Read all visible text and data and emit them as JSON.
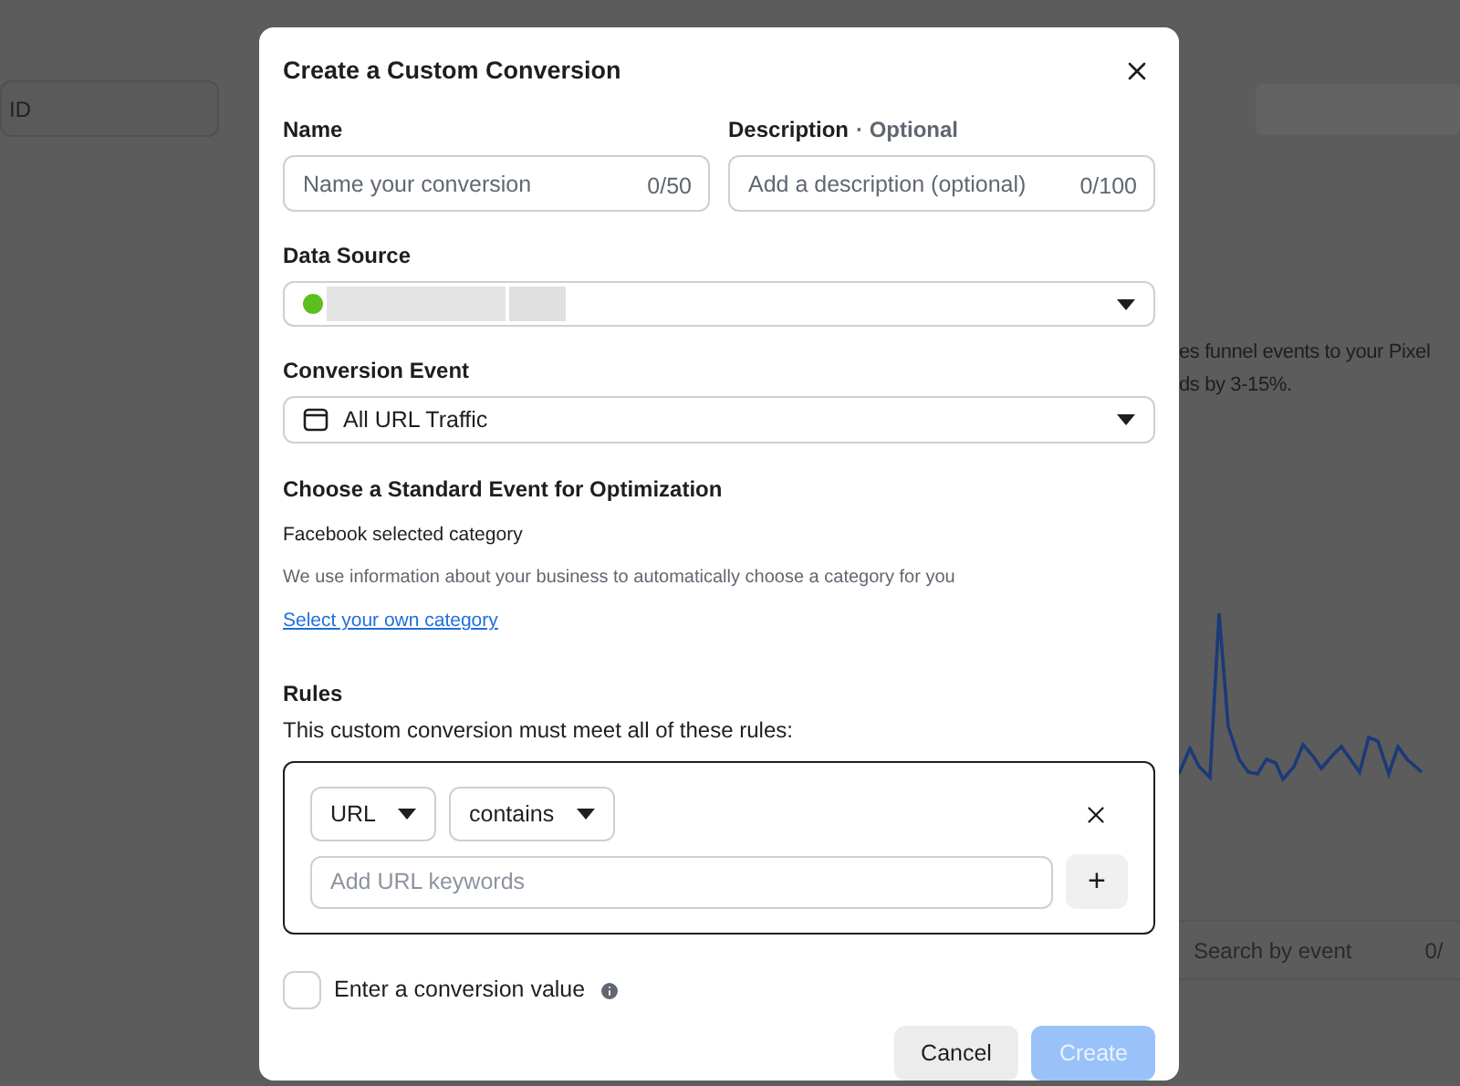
{
  "background": {
    "id_field": "ID",
    "description_lines": [
      "es funnel events to your Pixel",
      "ds by 3-15%."
    ],
    "search": {
      "placeholder": "Search by event",
      "counter": "0/"
    }
  },
  "dialog": {
    "title": "Create a Custom Conversion",
    "name": {
      "label": "Name",
      "placeholder": "Name your conversion",
      "counter": "0/50"
    },
    "description": {
      "label": "Description",
      "optional": "· Optional",
      "placeholder": "Add a description (optional)",
      "counter": "0/100"
    },
    "data_source": {
      "label": "Data Source",
      "connected": true
    },
    "conversion_event": {
      "label": "Conversion Event",
      "value": "All URL Traffic"
    },
    "standard_event": {
      "heading": "Choose a Standard Event for Optimization",
      "subheading": "Facebook selected category",
      "help": "We use information about your business to automatically choose a category for you",
      "link": "Select your own category"
    },
    "rules": {
      "heading": "Rules",
      "subtitle": "This custom conversion must meet all of these rules:",
      "field": "URL",
      "operator": "contains",
      "placeholder": "Add URL keywords",
      "add": "+"
    },
    "conversion_value": {
      "label": "Enter a conversion value",
      "checked": false
    },
    "buttons": [
      {
        "label": "Cancel",
        "kind": "secondary",
        "disabled": false
      },
      {
        "label": "Create",
        "kind": "primary",
        "disabled": true
      }
    ]
  }
}
